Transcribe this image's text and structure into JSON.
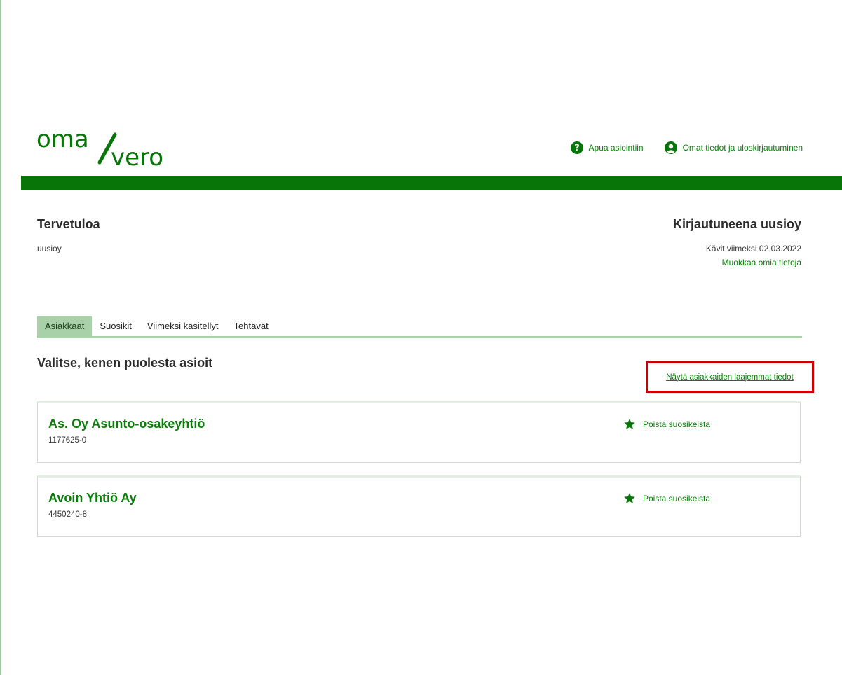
{
  "brand": {
    "logo_top": "oma",
    "logo_bottom": "vero",
    "color": "#087508"
  },
  "header": {
    "help_label": "Apua asiointiin",
    "help_icon": "question-circle-icon",
    "profile_label": "Omat tiedot ja uloskirjautuminen",
    "profile_icon": "user-circle-icon"
  },
  "welcome": {
    "title": "Tervetuloa",
    "username": "uusioy"
  },
  "login": {
    "title": "Kirjautuneena uusioy",
    "last_visit": "Kävit viimeksi 02.03.2022",
    "edit_link": "Muokkaa omia tietoja"
  },
  "tabs": [
    {
      "label": "Asiakkaat",
      "active": true
    },
    {
      "label": "Suosikit",
      "active": false
    },
    {
      "label": "Viimeksi käsitellyt",
      "active": false
    },
    {
      "label": "Tehtävät",
      "active": false
    }
  ],
  "section": {
    "title": "Valitse, kenen puolesta asioit",
    "details_link": "Näytä asiakkaiden laajemmat tiedot",
    "highlight_color": "#cc0000"
  },
  "customers": [
    {
      "name": "As. Oy Asunto-osakeyhtiö",
      "business_id": "1177625-0",
      "fav_label": "Poista suosikeista",
      "fav_icon": "star-icon"
    },
    {
      "name": "Avoin Yhtiö Ay",
      "business_id": "4450240-8",
      "fav_label": "Poista suosikeista",
      "fav_icon": "star-icon"
    }
  ]
}
